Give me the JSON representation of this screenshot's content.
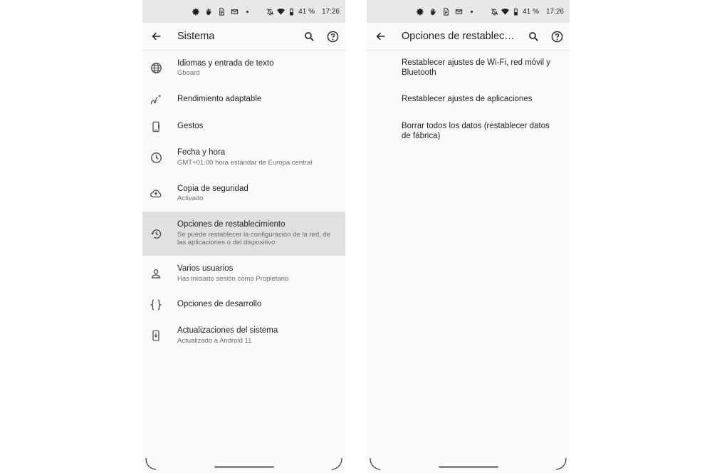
{
  "status_bar": {
    "battery": "41 %",
    "time": "17:26"
  },
  "left": {
    "title": "Sistema",
    "items": [
      {
        "title": "Idiomas y entrada de texto",
        "subtitle": "Gboard",
        "icon": "globe-icon"
      },
      {
        "title": "Rendimiento adaptable",
        "subtitle": "",
        "icon": "adaptive-performance-icon"
      },
      {
        "title": "Gestos",
        "subtitle": "",
        "icon": "gesture-phone-icon"
      },
      {
        "title": "Fecha y hora",
        "subtitle": "GMT+01:00 hora estándar de Europa central",
        "icon": "clock-icon"
      },
      {
        "title": "Copia de seguridad",
        "subtitle": "Activado",
        "icon": "cloud-upload-icon"
      },
      {
        "title": "Opciones de restablecimiento",
        "subtitle": "Se puede restablecer la configuración de la red, de las aplicaciones o del dispositivo",
        "icon": "history-icon",
        "selected": true
      },
      {
        "title": "Varios usuarios",
        "subtitle": "Has iniciado sesión como Propietario",
        "icon": "person-icon"
      },
      {
        "title": "Opciones de desarrollo",
        "subtitle": "",
        "icon": "braces-icon"
      },
      {
        "title": "Actualizaciones del sistema",
        "subtitle": "Actualizado a Android 11",
        "icon": "system-update-icon"
      }
    ]
  },
  "right": {
    "title": "Opciones de restablecimiento",
    "items": [
      {
        "title": "Restablecer ajustes de Wi-Fi, red móvil y Bluetooth"
      },
      {
        "title": "Restablecer ajustes de aplicaciones"
      },
      {
        "title": "Borrar todos los datos (restablecer datos de fábrica)"
      }
    ]
  },
  "colors": {
    "status_bar_bg": "#e8e8e8",
    "screen_bg": "#fafafa",
    "selected_bg": "#e0e0e0",
    "secondary_text": "#6b6b6b"
  }
}
